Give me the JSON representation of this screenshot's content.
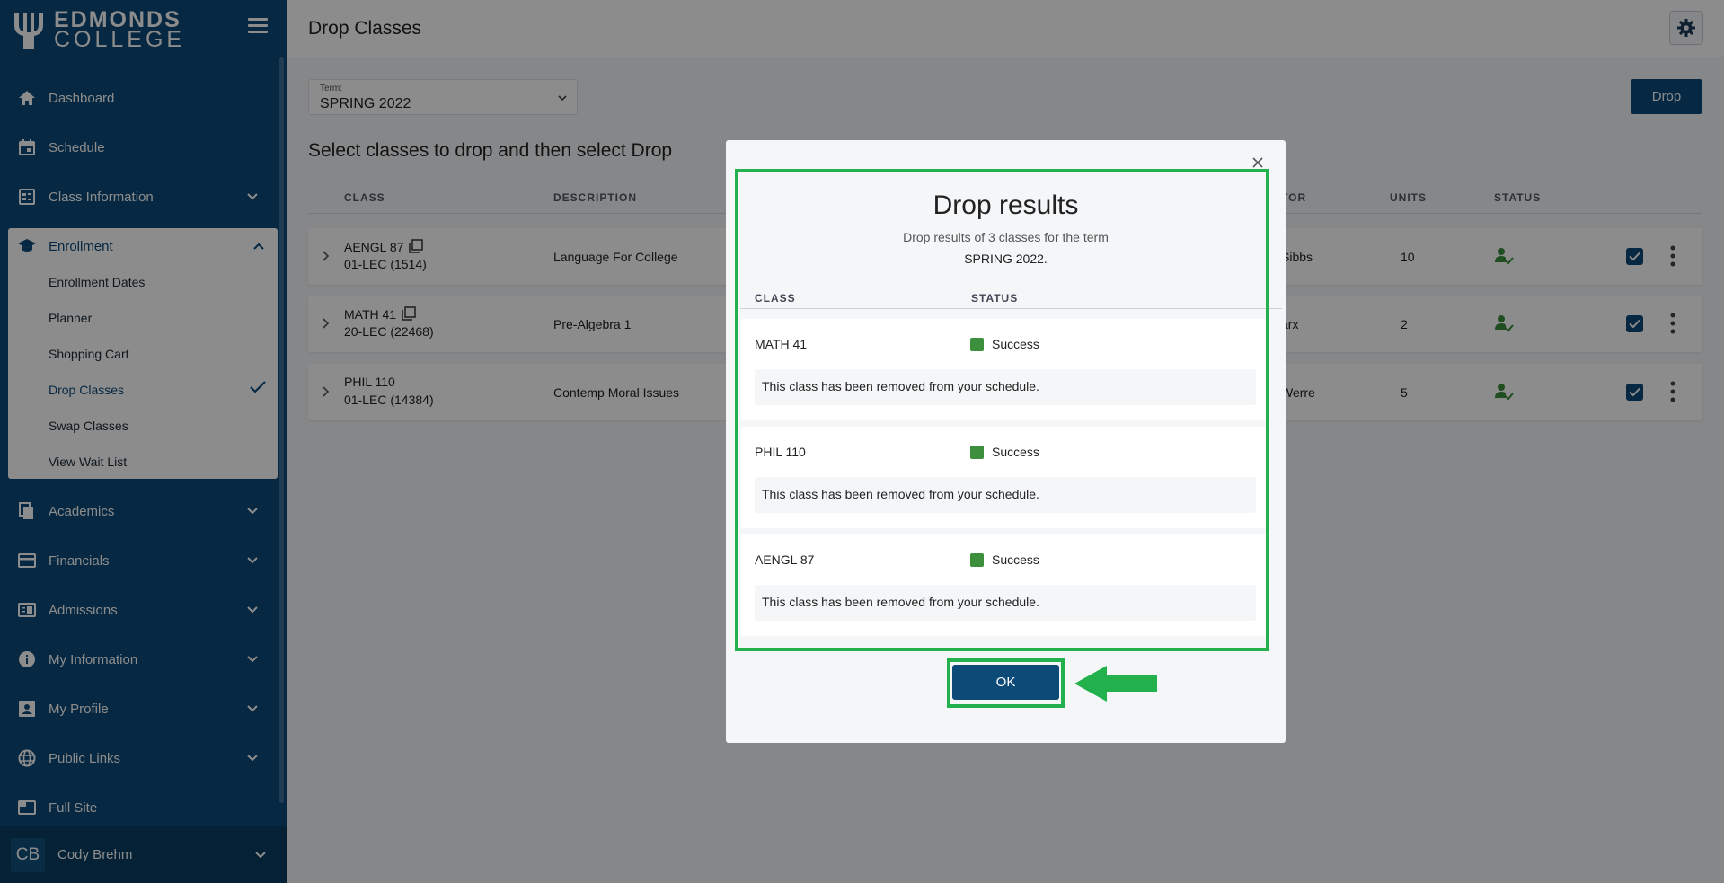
{
  "brand": {
    "line1": "EDMONDS",
    "line2": "COLLEGE"
  },
  "sidebar": {
    "items": [
      {
        "label": "Dashboard",
        "icon": "home-icon"
      },
      {
        "label": "Schedule",
        "icon": "calendar-icon"
      },
      {
        "label": "Class Information",
        "icon": "class-info-icon"
      },
      {
        "label": "Academics",
        "icon": "document-icon"
      },
      {
        "label": "Financials",
        "icon": "credit-card-icon"
      },
      {
        "label": "Admissions",
        "icon": "admissions-icon"
      },
      {
        "label": "My Information",
        "icon": "info-icon"
      },
      {
        "label": "My Profile",
        "icon": "profile-icon"
      },
      {
        "label": "Public Links",
        "icon": "globe-icon"
      },
      {
        "label": "Full Site",
        "icon": "window-icon"
      }
    ],
    "enrollment": {
      "label": "Enrollment",
      "icon": "graduation-cap-icon",
      "subitems": [
        "Enrollment Dates",
        "Planner",
        "Shopping Cart",
        "Drop Classes",
        "Swap Classes",
        "View Wait List"
      ],
      "active": "Drop Classes"
    },
    "user": {
      "initials": "CB",
      "name": "Cody Brehm"
    }
  },
  "header": {
    "title": "Drop Classes"
  },
  "term": {
    "label": "Term:",
    "value": "SPRING 2022"
  },
  "drop_button": "Drop",
  "section_title": "Select classes to drop and then select Drop",
  "table": {
    "headers": {
      "class": "CLASS",
      "description": "DESCRIPTION",
      "instructor": "TOR",
      "units": "UNITS",
      "status": "STATUS"
    },
    "rows": [
      {
        "class": "AENGL 87",
        "section": "01-LEC (1514)",
        "description": "Language For College",
        "instructor": "Sibbs",
        "units": "10"
      },
      {
        "class": "MATH 41",
        "section": "20-LEC (22468)",
        "description": "Pre-Algebra 1",
        "instructor": "arx",
        "units": "2"
      },
      {
        "class": "PHIL 110",
        "section": "01-LEC (14384)",
        "description": "Contemp Moral Issues",
        "instructor": "Werre",
        "units": "5"
      }
    ]
  },
  "modal": {
    "title": "Drop results",
    "subtitle": "Drop results of 3 classes for the term",
    "term": "SPRING 2022.",
    "headers": {
      "class": "CLASS",
      "status": "STATUS"
    },
    "results": [
      {
        "class": "MATH 41",
        "status": "Success",
        "message": "This class has been removed from your schedule."
      },
      {
        "class": "PHIL 110",
        "status": "Success",
        "message": "This class has been removed from your schedule."
      },
      {
        "class": "AENGL 87",
        "status": "Success",
        "message": "This class has been removed from your schedule."
      }
    ],
    "ok_label": "OK"
  },
  "colors": {
    "primary": "#0c4a78",
    "success": "#3c8f3c",
    "highlight": "#22b14c"
  }
}
